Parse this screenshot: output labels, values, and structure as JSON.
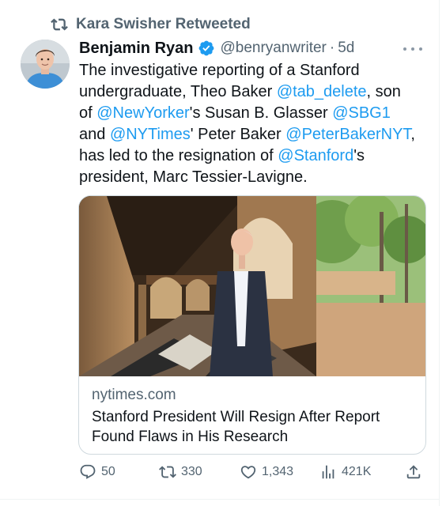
{
  "retweet_header": {
    "text": "Kara Swisher Retweeted",
    "icon": "retweet-icon"
  },
  "author": {
    "display_name": "Benjamin Ryan",
    "verified_icon": "verified-badge-icon",
    "handle": "@benryanwriter",
    "separator": "·",
    "time": "5d"
  },
  "tweet": {
    "lines": [
      [
        {
          "t": "The investigative reporting of a Stanford"
        }
      ],
      [
        {
          "t": "undergraduate, Theo Baker "
        },
        {
          "t": "@tab_delete",
          "m": true
        },
        {
          "t": ", son"
        }
      ],
      [
        {
          "t": "of "
        },
        {
          "t": "@NewYorker",
          "m": true
        },
        {
          "t": "'s Susan B. Glasser "
        },
        {
          "t": "@SBG1",
          "m": true
        }
      ],
      [
        {
          "t": "and "
        },
        {
          "t": "@NYTimes",
          "m": true
        },
        {
          "t": "' Peter Baker "
        },
        {
          "t": "@PeterBakerNYT",
          "m": true
        },
        {
          "t": ","
        }
      ],
      [
        {
          "t": "has led to the resignation of "
        },
        {
          "t": "@Stanford",
          "m": true
        },
        {
          "t": "'s"
        }
      ],
      [
        {
          "t": "president, Marc Tessier-Lavigne."
        }
      ]
    ]
  },
  "card": {
    "domain": "nytimes.com",
    "title": "Stanford President Will Resign After Report Found Flaws in His Research"
  },
  "actions": {
    "reply_count": "50",
    "retweet_count": "330",
    "like_count": "1,343",
    "views_count": "421K"
  },
  "colors": {
    "accent": "#1d9bf0",
    "text": "#0f1419",
    "secondary": "#536471"
  }
}
